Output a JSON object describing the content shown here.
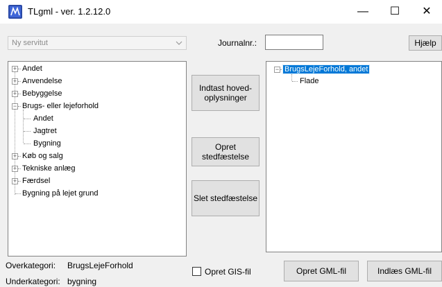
{
  "window": {
    "title": "TLgml - ver. 1.2.12.0",
    "minimize": "—",
    "maximize": "☐",
    "close": "✕"
  },
  "top": {
    "servitut_placeholder": "Ny servitut",
    "journal_label": "Journalnr.:",
    "journal_value": "",
    "help_label": "Hjælp"
  },
  "left_tree": [
    {
      "label": "Andet",
      "expanded": false
    },
    {
      "label": "Anvendelse",
      "expanded": false
    },
    {
      "label": "Bebyggelse",
      "expanded": false
    },
    {
      "label": "Brugs- eller lejeforhold",
      "expanded": true,
      "children": [
        "Andet",
        "Jagtret",
        "Bygning"
      ]
    },
    {
      "label": "Køb og salg",
      "expanded": false
    },
    {
      "label": "Tekniske anlæg",
      "expanded": false
    },
    {
      "label": "Færdsel",
      "expanded": false
    },
    {
      "label": "Bygning på lejet grund",
      "leaf": true
    }
  ],
  "actions": {
    "indtast": "Indtast hoved-oplysninger",
    "opret_sted": "Opret stedfæstelse",
    "slet_sted": "Slet stedfæstelse"
  },
  "right_tree": {
    "root": "BrugsLejeForhold, andet",
    "child": "Flade"
  },
  "bottom": {
    "over_label": "Overkategori:",
    "over_value": "BrugsLejeForhold",
    "under_label": "Underkategori:",
    "under_value": "bygning",
    "gis_label": "Opret GIS-fil",
    "gis_checked": false,
    "opret_gml": "Opret GML-fil",
    "indlaes_gml": "Indlæs GML-fil"
  },
  "colors": {
    "selection": "#0078d7",
    "button_face": "#e1e1e1",
    "window_bg": "#f0f0f0"
  }
}
